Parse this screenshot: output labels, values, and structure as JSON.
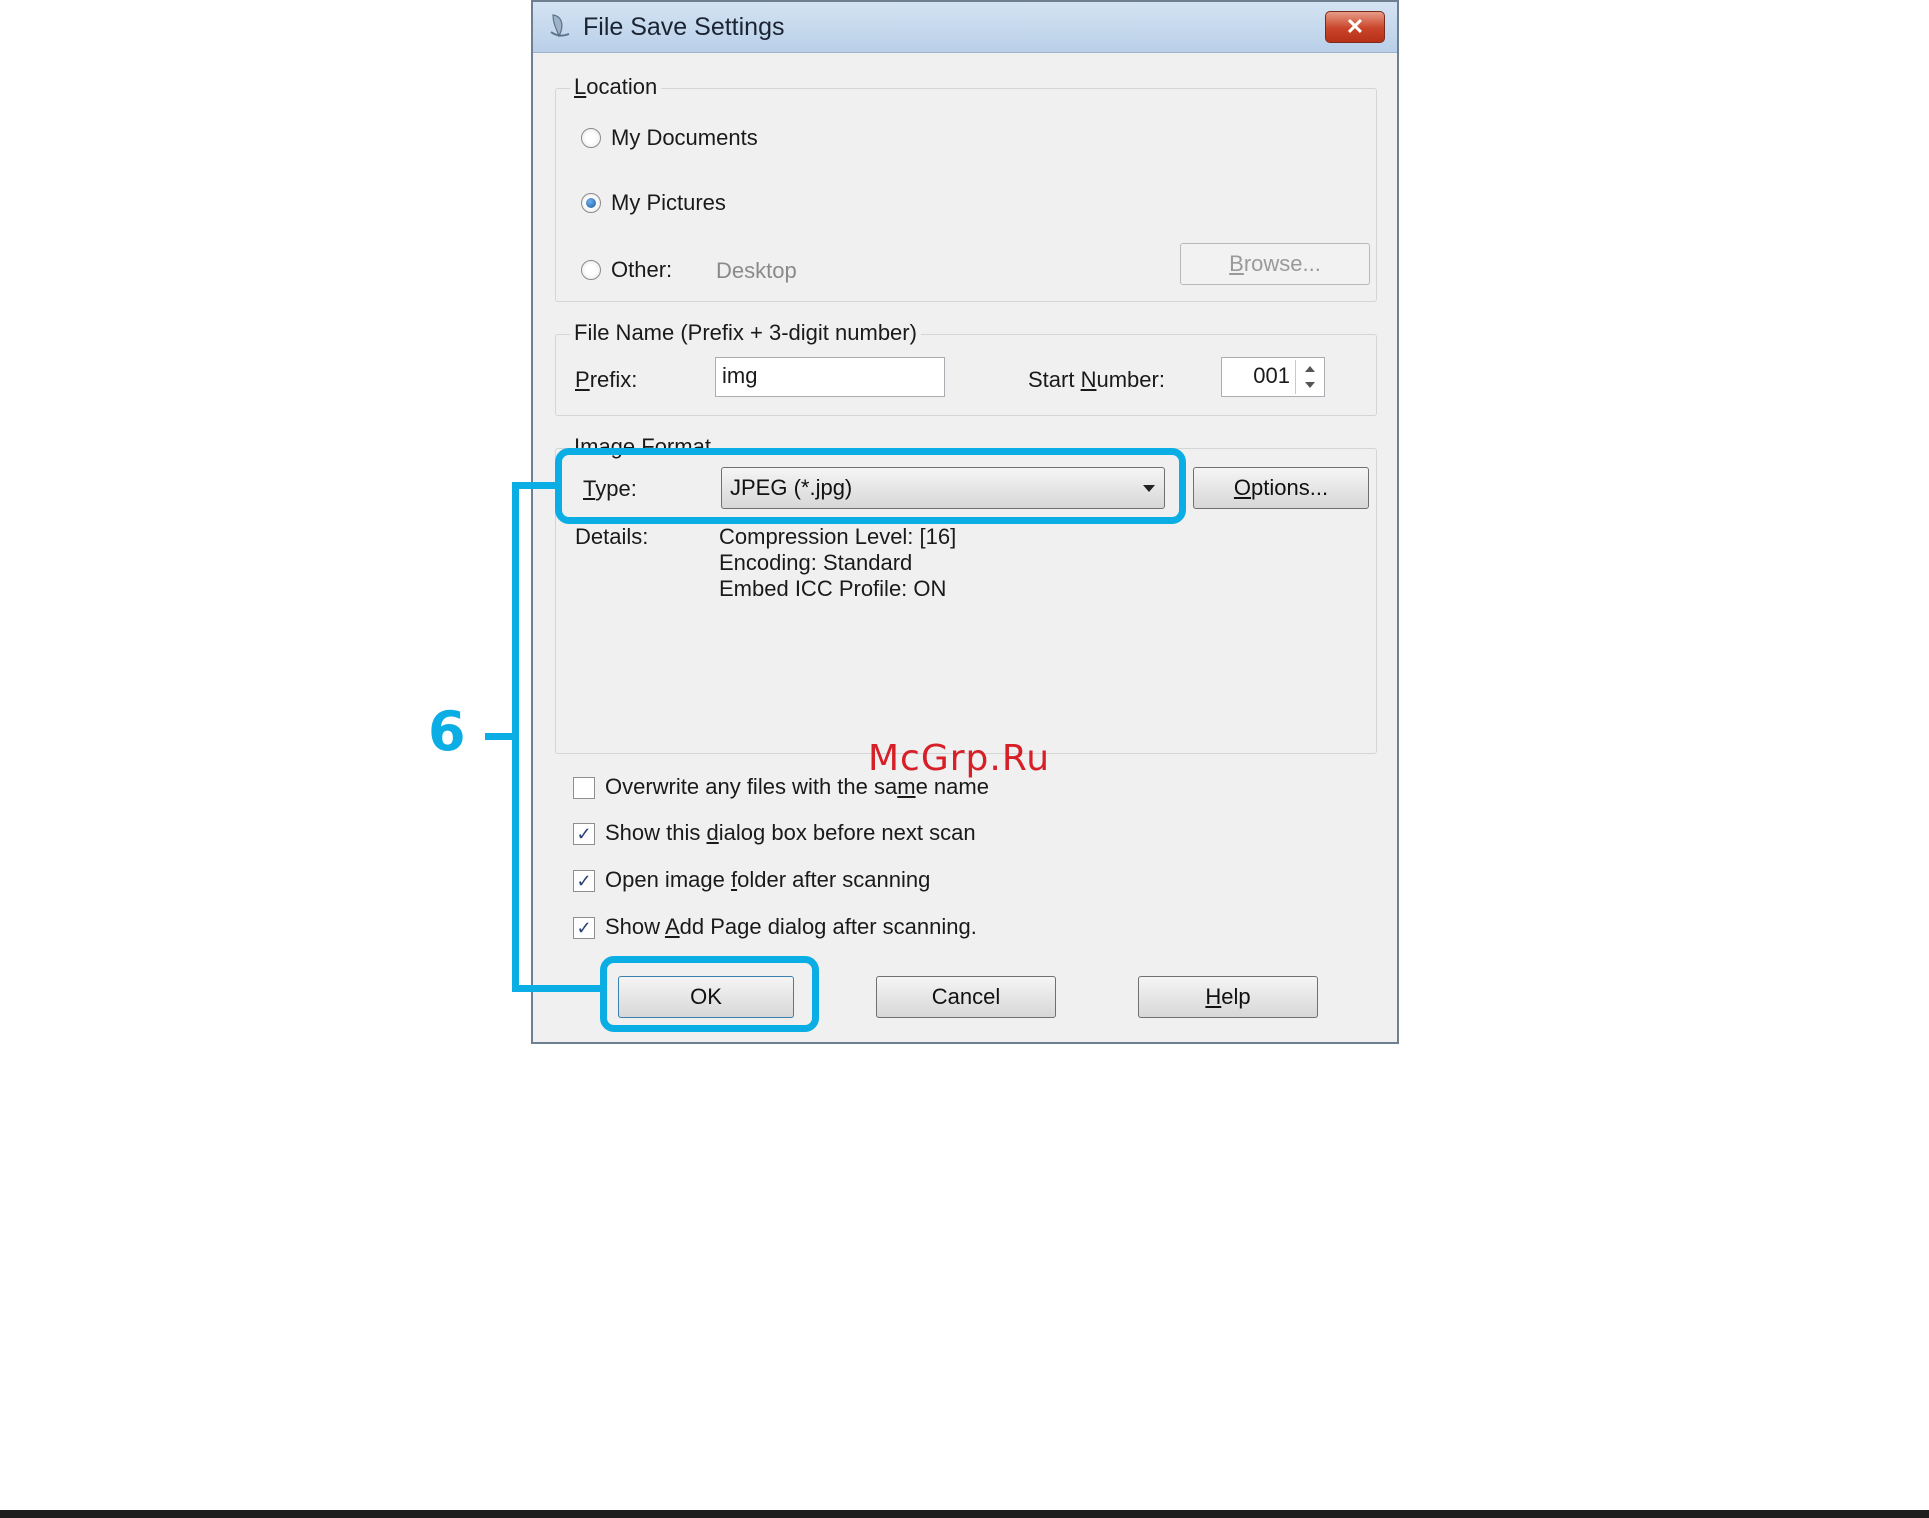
{
  "dialog": {
    "title": "File Save Settings",
    "close_label": "✕",
    "location": {
      "label_prefix": "",
      "label_u": "L",
      "label_rest": "ocation",
      "options": [
        {
          "label": "My Documents",
          "selected": false
        },
        {
          "label": "My Pictures",
          "selected": true
        },
        {
          "label": "Other:",
          "selected": false
        }
      ],
      "other_value": "Desktop",
      "browse_u": "B",
      "browse_rest": "rowse..."
    },
    "file_name": {
      "label": "File Name (Prefix + 3-digit number)",
      "prefix_u": "P",
      "prefix_rest": "refix:",
      "prefix_value": "img",
      "start_pre": "Start ",
      "start_u": "N",
      "start_rest": "umber:",
      "start_value": "001"
    },
    "image_format": {
      "label": "Image Format",
      "type_u": "T",
      "type_rest": "ype:",
      "type_value": "JPEG (*.jpg)",
      "options_u": "O",
      "options_rest": "ptions...",
      "details_label": "Details:",
      "details": [
        "Compression Level: [16]",
        "Encoding: Standard",
        "Embed ICC Profile: ON"
      ]
    },
    "checkboxes": [
      {
        "pre": "Overwrite any files with the sa",
        "u": "m",
        "post": "e name",
        "checked": false
      },
      {
        "pre": "Show this ",
        "u": "d",
        "post": "ialog box before next scan",
        "checked": true
      },
      {
        "pre": "Open image ",
        "u": "f",
        "post": "older after scanning",
        "checked": true
      },
      {
        "pre": "Show ",
        "u": "A",
        "post": "dd Page dialog after scanning.",
        "checked": true
      }
    ],
    "buttons": {
      "ok": "OK",
      "cancel": "Cancel",
      "help_u": "H",
      "help_rest": "elp"
    }
  },
  "annotation": {
    "step_number": "6",
    "highlight_color": "#0aaee4"
  },
  "watermark": "McGrp.Ru"
}
